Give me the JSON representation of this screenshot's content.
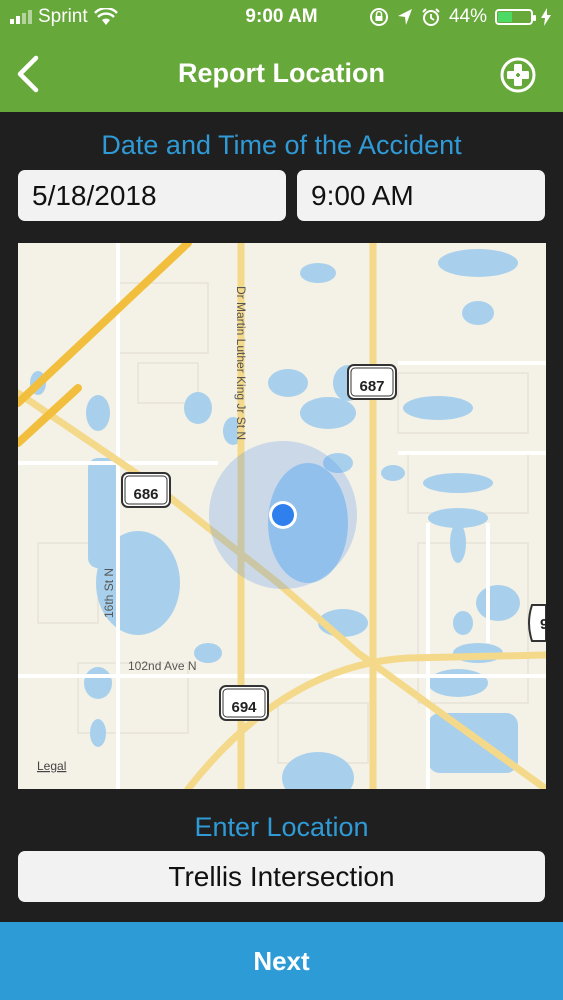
{
  "status_bar": {
    "carrier": "Sprint",
    "time": "9:00 AM",
    "battery": "44%",
    "battery_level": 0.44,
    "icons": [
      "signal-icon",
      "wifi-icon",
      "lock-rotation-icon",
      "location-arrow-icon",
      "alarm-icon",
      "battery-icon",
      "charging-icon"
    ]
  },
  "nav": {
    "title": "Report Location",
    "back_icon": "chevron-left-icon",
    "action_icon": "add-medical-icon"
  },
  "date_time": {
    "label": "Date and Time of the Accident",
    "date": "5/18/2018",
    "time": "9:00 AM"
  },
  "map": {
    "labels": {
      "road_687": "687",
      "road_686": "686",
      "road_694": "694",
      "road_9": "9",
      "mlk": "Dr Martin Luther King Jr St N",
      "street_16th": "16th St N",
      "ave_102nd": "102nd Ave N",
      "legal": "Legal"
    }
  },
  "location": {
    "label": "Enter Location",
    "value": "Trellis Intersection"
  },
  "footer": {
    "next_label": "Next"
  },
  "colors": {
    "header_green": "#67a83a",
    "accent_blue": "#2c9bd6",
    "label_blue": "#2f9ad6",
    "background": "#1f1f1f"
  }
}
